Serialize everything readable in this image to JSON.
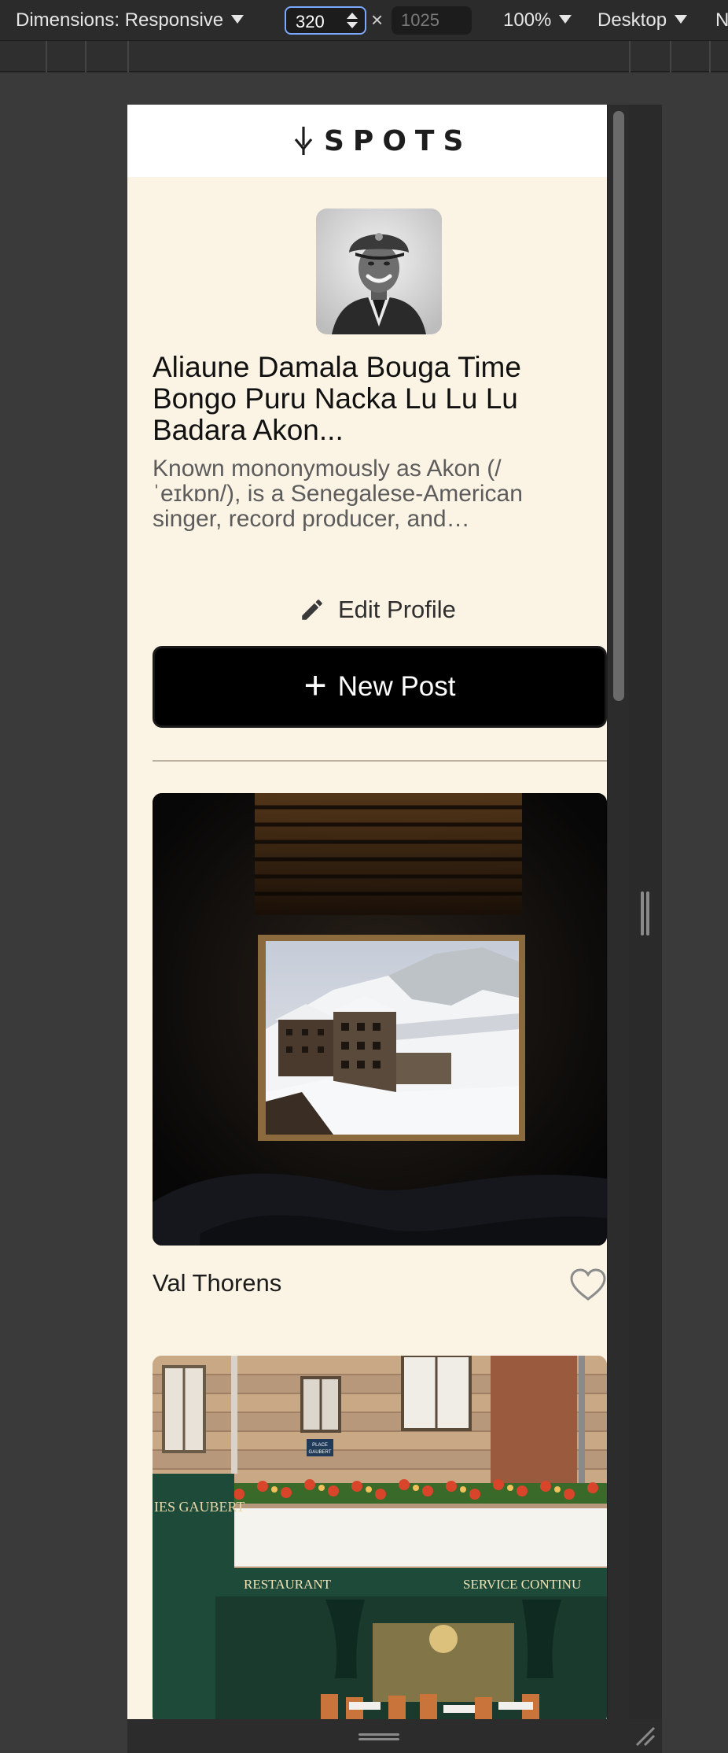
{
  "devtools": {
    "dimensions_label": "Dimensions: Responsive",
    "width_value": "320",
    "height_placeholder": "1025",
    "times": "×",
    "zoom_label": "100%",
    "device_label": "Desktop",
    "overflow_label": "N"
  },
  "site": {
    "logo_text": "SPOTS",
    "profile": {
      "name": "Aliaune Damala Bouga Time Bongo Puru Nacka Lu Lu Lu Badara Akon...",
      "description": "Known mononymously as Akon (/ ˈeɪkɒn/), is a Senegalese-American singer, record producer, and…",
      "edit_label": "Edit Profile"
    },
    "new_post_label": "New Post",
    "new_post_icon": "+",
    "cards": [
      {
        "title": "Val Thorens",
        "image": "window view of snowy mountain village",
        "liked": false
      },
      {
        "title": "",
        "image": "restaurant facade with flower boxes",
        "sign_left": "IES GAUBERT",
        "sign_restaurant": "RESTAURANT",
        "sign_service": "SERVICE CONTINU",
        "plaque": "PLACE GAUBERT"
      }
    ]
  },
  "colors": {
    "page_bg": "#fbf3e4",
    "header_bg": "#ffffff",
    "button_bg": "#000000",
    "devtools_bg": "#2b2b2b",
    "focus_ring": "#7aa7ff"
  }
}
